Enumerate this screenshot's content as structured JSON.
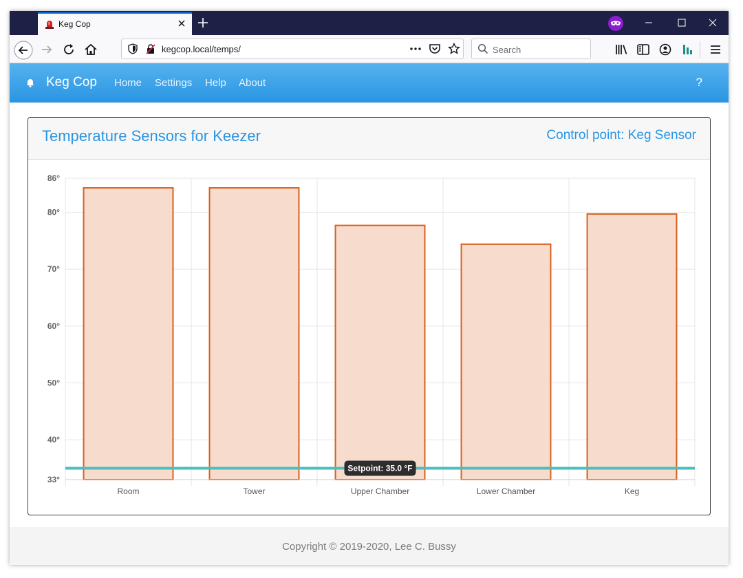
{
  "browser": {
    "tab_title": "Keg Cop",
    "url": "kegcop.local/temps/",
    "search_placeholder": "Search",
    "icons": [
      "siren-favicon",
      "close-icon",
      "plus-icon",
      "private-mask-icon",
      "minimize-icon",
      "maximize-icon",
      "window-close-icon",
      "back-icon",
      "forward-icon",
      "reload-icon",
      "home-icon",
      "shield-icon",
      "insecure-lock-icon",
      "more-icon",
      "pocket-icon",
      "bookmark-star-icon",
      "search-icon",
      "library-icon",
      "sidebar-icon",
      "account-icon",
      "extension-icon",
      "menu-icon"
    ]
  },
  "app_nav": {
    "brand": "Keg Cop",
    "links": [
      "Home",
      "Settings",
      "Help",
      "About"
    ],
    "help_symbol": "?"
  },
  "card": {
    "title": "Temperature Sensors for Keezer",
    "control_point": "Control point: Keg Sensor"
  },
  "chart_data": {
    "type": "bar",
    "categories": [
      "Room",
      "Tower",
      "Upper Chamber",
      "Lower Chamber",
      "Keg"
    ],
    "values": [
      84.3,
      84.3,
      77.7,
      74.4,
      79.7
    ],
    "ylim": [
      33,
      86
    ],
    "yticks": [
      {
        "value": 33,
        "label": "33°"
      },
      {
        "value": 40,
        "label": "40°"
      },
      {
        "value": 50,
        "label": "50°"
      },
      {
        "value": 60,
        "label": "60°"
      },
      {
        "value": 70,
        "label": "70°"
      },
      {
        "value": 80,
        "label": "80°"
      },
      {
        "value": 86,
        "label": "86°"
      }
    ],
    "setpoint": {
      "value": 35.0,
      "label": "Setpoint: 35.0 °F"
    },
    "colors": {
      "bar_fill": "#f7dccd",
      "bar_stroke": "#d95f1e",
      "setpoint_line": "#4dbdbd",
      "grid": "#e6e6e6"
    },
    "grid": true,
    "legend": "none"
  },
  "footer": {
    "copyright": "Copyright © 2019-2020, Lee C. Bussy"
  }
}
